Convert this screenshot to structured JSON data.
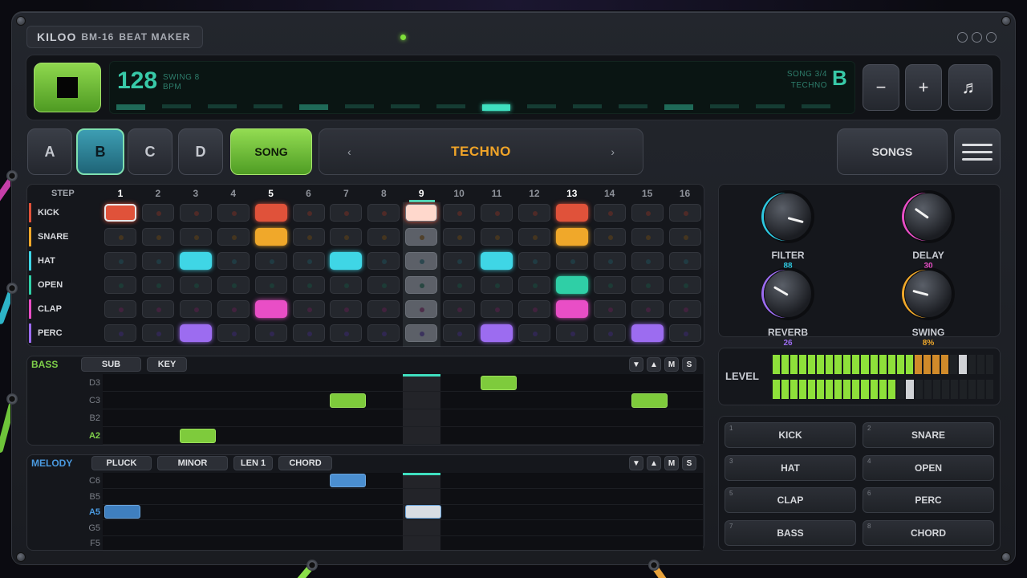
{
  "header": {
    "brand": "KILOO",
    "model": "BM-16",
    "subtitle": "BEAT MAKER"
  },
  "transport": {
    "bpm": "128",
    "swing_label": "SWING 8",
    "bpm_unit": "BPM",
    "song_pos": "SONG 3/4",
    "style_name": "TECHNO",
    "pattern_letter": "B",
    "minus_label": "−",
    "plus_label": "+",
    "note_icon": "♬"
  },
  "patterns": {
    "a": "A",
    "b": "B",
    "c": "C",
    "d": "D",
    "song": "SONG"
  },
  "style_selector": {
    "prev": "‹",
    "name": "TECHNO",
    "next": "›"
  },
  "songs_label": "SONGS",
  "sequencer": {
    "step_label": "STEP",
    "steps": [
      "1",
      "2",
      "3",
      "4",
      "5",
      "6",
      "7",
      "8",
      "9",
      "10",
      "11",
      "12",
      "13",
      "14",
      "15",
      "16"
    ],
    "current_step": 9,
    "tracks": [
      {
        "name": "KICK",
        "color": "#e0523a",
        "dot": "#5a2c26"
      },
      {
        "name": "SNARE",
        "color": "#f0a82a",
        "dot": "#4d3a1c"
      },
      {
        "name": "HAT",
        "color": "#3fd6e6",
        "dot": "#1f4148"
      },
      {
        "name": "OPEN",
        "color": "#2fcfa6",
        "dot": "#1c4138"
      },
      {
        "name": "CLAP",
        "color": "#e94ec6",
        "dot": "#4a2242"
      },
      {
        "name": "PERC",
        "color": "#9c6cf0",
        "dot": "#33285a"
      }
    ]
  },
  "bass": {
    "label": "BASS",
    "chips": [
      "SUB",
      "KEY"
    ],
    "controls": [
      "▼",
      "▲",
      "M",
      "S"
    ],
    "notes": [
      "D3",
      "C3",
      "B2",
      "A2"
    ]
  },
  "melody": {
    "label": "MELODY",
    "chips": [
      "PLUCK",
      "MINOR",
      "LEN 1",
      "CHORD"
    ],
    "controls": [
      "▼",
      "▲",
      "M",
      "S"
    ],
    "notes": [
      "C6",
      "B5",
      "A5",
      "G5",
      "F5"
    ]
  },
  "fx": [
    {
      "name": "FILTER",
      "value": "88",
      "color": "#2ec8e0"
    },
    {
      "name": "DELAY",
      "value": "30",
      "color": "#e94ec6"
    },
    {
      "name": "REVERB",
      "value": "26",
      "color": "#9c6cf0"
    },
    {
      "name": "SWING",
      "value": "8%",
      "color": "#f0a82a"
    }
  ],
  "level": {
    "label": "LEVEL",
    "left": 0.82,
    "right": 0.58
  },
  "pads": [
    {
      "num": "1",
      "label": "KICK"
    },
    {
      "num": "2",
      "label": "SNARE"
    },
    {
      "num": "3",
      "label": "HAT"
    },
    {
      "num": "4",
      "label": "OPEN"
    },
    {
      "num": "5",
      "label": "CLAP"
    },
    {
      "num": "6",
      "label": "PERC"
    },
    {
      "num": "7",
      "label": "BASS"
    },
    {
      "num": "8",
      "label": "CHORD"
    }
  ]
}
